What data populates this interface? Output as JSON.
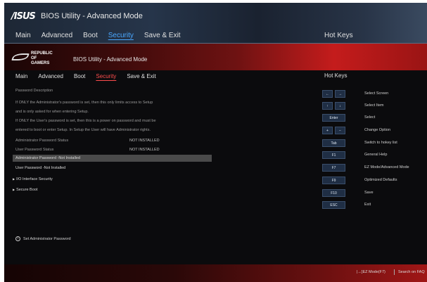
{
  "asus_header": {
    "logo": "/ISUS",
    "title": "BIOS Utility - Advanced Mode",
    "tabs": [
      "Main",
      "Advanced",
      "Boot",
      "Security",
      "Save & Exit"
    ],
    "active_tab": "Security",
    "hot_keys_label": "Hot Keys"
  },
  "rog_header": {
    "logo_line1": "REPUBLIC OF",
    "logo_line2": "GAMERS",
    "title": "BIOS Utility - Advanced Mode",
    "tabs": [
      "Main",
      "Advanced",
      "Boot",
      "Security",
      "Save & Exit"
    ],
    "active_tab": "Security",
    "hot_keys_label": "Hot Keys"
  },
  "security": {
    "description_heading": "Password Description",
    "desc_lines": [
      "If ONLY the Administrator's password is set, then this only limits access to Setup",
      "and is only asked for when entering Setup.",
      "If ONLY the User's password is set, then this is a power on password and must be",
      "entered to boot or enter Setup. In Setup the User will have Administrator rights."
    ],
    "admin_status_label": "Administrator Password Status",
    "admin_status_value": "NOT INSTALLED",
    "user_status_label": "User Password Status",
    "user_status_value": "NOT INSTALLED",
    "admin_password_item": "Administrator Password -Not Installed",
    "user_password_item": "User Password -Not Installed",
    "io_interface": "I/O Interface Security",
    "secure_boot": "Secure Boot",
    "help_text": "Set Administrator Password"
  },
  "hot_keys": [
    {
      "keys": [
        "←",
        "→"
      ],
      "desc": "Select Screen"
    },
    {
      "keys": [
        "↑",
        "↓"
      ],
      "desc": "Select Item"
    },
    {
      "keys": [
        "Enter"
      ],
      "desc": "Select"
    },
    {
      "keys": [
        "+",
        "−"
      ],
      "desc": "Change Option"
    },
    {
      "keys": [
        "Tab"
      ],
      "desc": "Switch to hokey list"
    },
    {
      "keys": [
        "F1"
      ],
      "desc": "General Help"
    },
    {
      "keys": [
        "F7"
      ],
      "desc": "EZ Mode/Advanced Mode"
    },
    {
      "keys": [
        "F9"
      ],
      "desc": "Optimized Defaults"
    },
    {
      "keys": [
        "F10"
      ],
      "desc": "Save"
    },
    {
      "keys": [
        "ESC"
      ],
      "desc": "Exit"
    }
  ],
  "footer": {
    "ez_mode": "|→]EZ Mode(F7)",
    "search": "Search on FAQ"
  },
  "colors": {
    "active_tab_asus": "#4aa7ff",
    "active_tab_rog": "#ff4d4d",
    "accent_red": "#c41c1c"
  }
}
